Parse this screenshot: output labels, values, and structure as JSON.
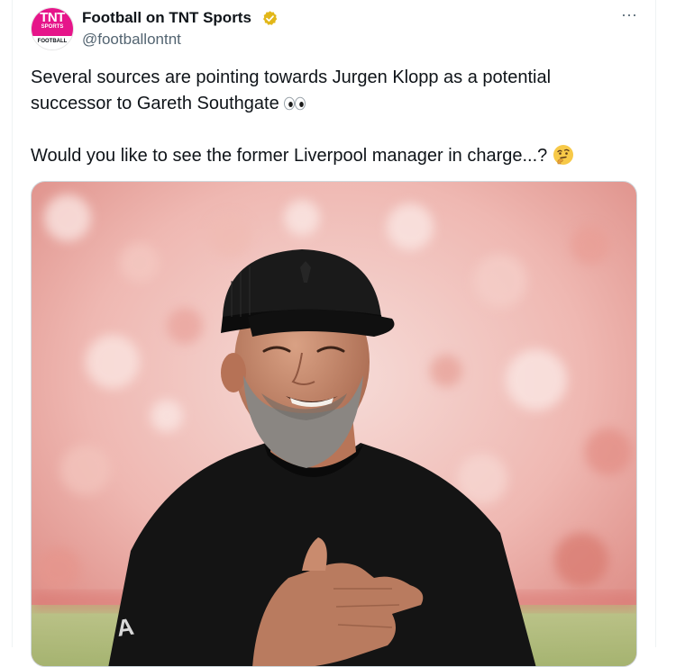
{
  "tweet": {
    "display_name": "Football on TNT Sports",
    "handle": "@footballontnt",
    "verified": true,
    "text_line_1": "Several sources are pointing towards Jurgen Klopp as a potential",
    "text_line_2": "successor to Gareth Southgate",
    "text_line_3": "Would you like to see the former Liverpool manager in charge...?",
    "more_label": "···"
  },
  "avatar": {
    "brand_top": "TNT",
    "brand_mid": "SPORTS",
    "brand_bottom": "FOOTBALL",
    "brand_color": "#e6158a"
  },
  "icons": {
    "verified": "gold-check-badge-icon",
    "more": "more-options-icon",
    "eyes": "eyes-emoji-icon",
    "thinking": "thinking-face-emoji-icon"
  },
  "colors": {
    "text": "#0f1419",
    "secondary": "#536471",
    "border": "#cfd9de",
    "verified_gold": "#e2b719"
  },
  "media": {
    "kind": "photo"
  }
}
